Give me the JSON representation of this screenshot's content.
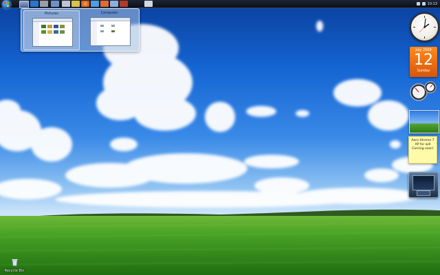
{
  "taskbar": {
    "buttons": [
      "start-orb",
      "show-desktop",
      "media-player",
      "app",
      "app",
      "app",
      "explorer",
      "firefox",
      "app",
      "app",
      "app",
      "app"
    ],
    "clock": "10:13"
  },
  "thumbnails": [
    {
      "title": "Pictures"
    },
    {
      "title": "Computer"
    }
  ],
  "gadgets": {
    "calendar": {
      "month": "July 2009",
      "day": "12",
      "weekday": "Sunday"
    },
    "note": {
      "lines": [
        "Aero Xtreme 7",
        "XP for will",
        "Coming soon!"
      ]
    }
  },
  "desktop_icons": [
    {
      "label": "Recycle Bin",
      "icon": "recycle-bin-icon"
    }
  ],
  "colors": {
    "taskbar": "#0a0f19",
    "sky": "#1565d3",
    "grass": "#3f9a1f",
    "calendar": "#ff8a1c",
    "note": "#fffaa8"
  }
}
